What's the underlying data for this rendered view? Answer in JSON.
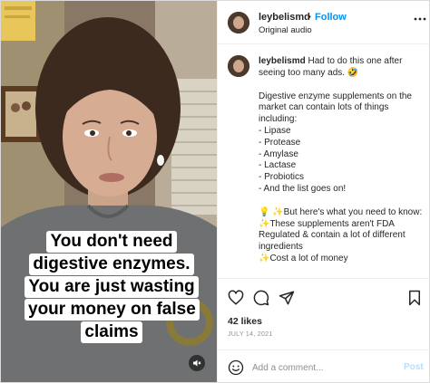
{
  "video": {
    "caption_lines": [
      "You don't need",
      "digestive enzymes.",
      "You are just wasting",
      "your money on false",
      "claims"
    ],
    "mute_icon": "speaker-muted-icon"
  },
  "header": {
    "username": "leybelismd",
    "separator": "•",
    "follow_label": "Follow",
    "audio_label": "Original audio",
    "more_icon": "more-horizontal-icon"
  },
  "comment": {
    "username": "leybelismd",
    "lines": [
      "Had to do this one after seeing too many ads. 🤣",
      "",
      "Digestive enzyme supplements on the market can contain lots of things including:",
      "- Lipase",
      "- Protease",
      "- Amylase",
      "- Lactase",
      "- Probiotics",
      "- And the list goes on!",
      "",
      "💡 ✨But here's what you need to know:",
      "✨These supplements aren't FDA Regulated & contain a lot of different ingredients",
      "✨Cost a lot of money"
    ]
  },
  "actions": {
    "icons": [
      "heart-icon",
      "comment-icon",
      "share-icon",
      "bookmark-icon"
    ],
    "likes": "42 likes",
    "date": "JULY 14, 2021"
  },
  "add_comment": {
    "emoji_icon": "emoji-icon",
    "placeholder": "Add a comment...",
    "post_label": "Post"
  },
  "colors": {
    "follow_blue": "#0095f6",
    "post_disabled": "#b2dffc",
    "muted_text": "#8e8e8e",
    "text": "#262626",
    "border": "#efefef"
  }
}
